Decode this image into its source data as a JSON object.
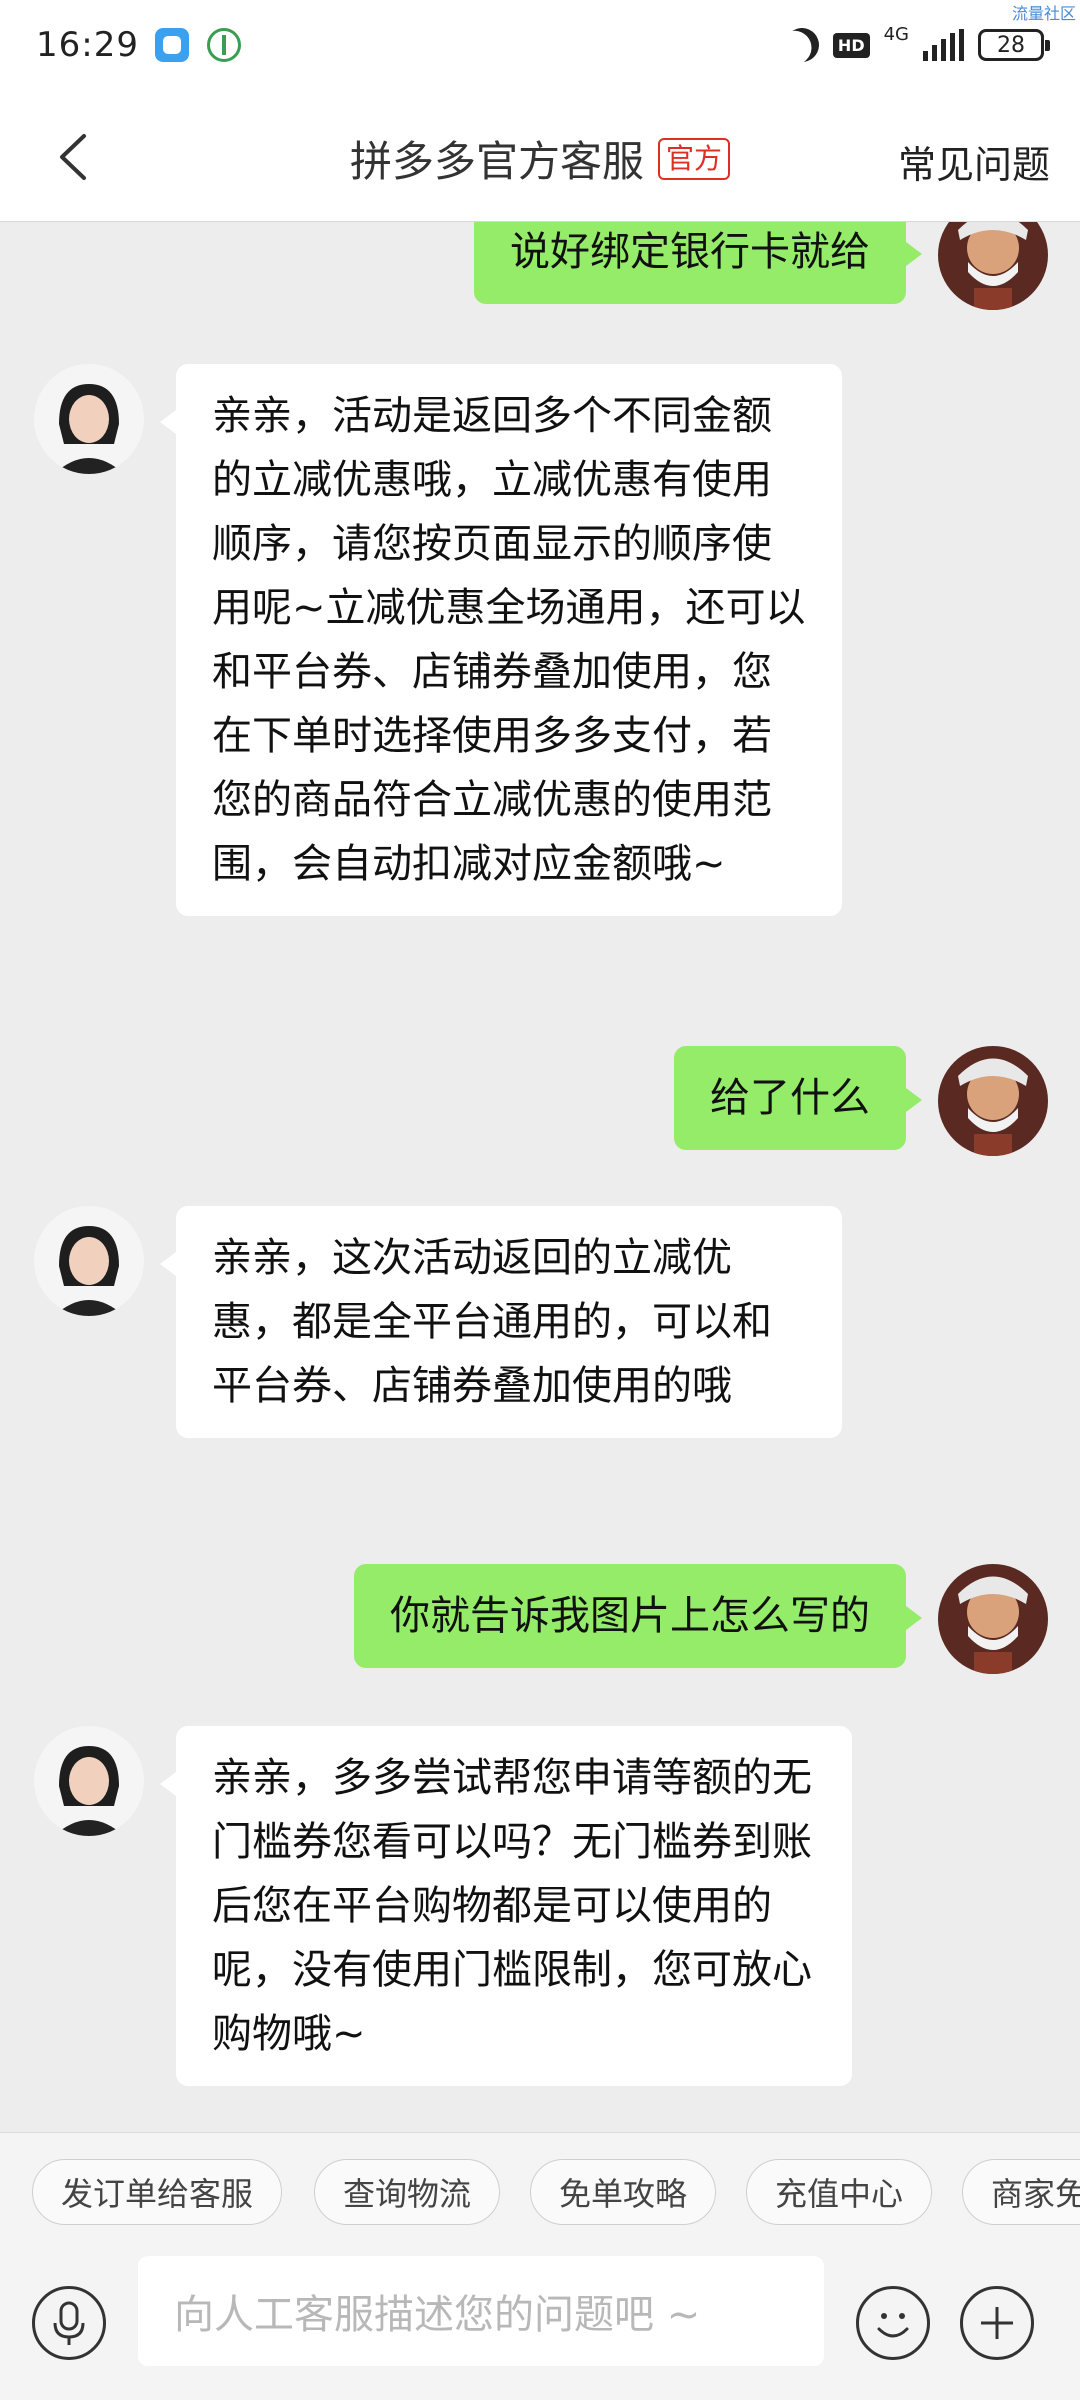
{
  "status_bar": {
    "time": "16:29",
    "hd": "HD",
    "network": "4G",
    "battery": "28",
    "watermark": "流量社区"
  },
  "header": {
    "title": "拼多多官方客服",
    "badge": "官方",
    "faq": "常见问题"
  },
  "messages": [
    {
      "from": "user",
      "text": "说好绑定银行卡就给"
    },
    {
      "from": "agent",
      "text": "亲亲，活动是返回多个不同金额的立减优惠哦，立减优惠有使用顺序，请您按页面显示的顺序使用呢~立减优惠全场通用，还可以和平台券、店铺券叠加使用，您在下单时选择使用多多支付，若您的商品符合立减优惠的使用范围，会自动扣减对应金额哦~"
    },
    {
      "from": "user",
      "text": "给了什么"
    },
    {
      "from": "agent",
      "text": "亲亲，这次活动返回的立减优惠，都是全平台通用的，可以和平台券、店铺券叠加使用的哦"
    },
    {
      "from": "user",
      "text": "你就告诉我图片上怎么写的"
    },
    {
      "from": "agent",
      "text": "亲亲，多多尝试帮您申请等额的无门槛券您看可以吗？无门槛券到账后您在平台购物都是可以使用的呢，没有使用门槛限制，您可放心购物哦~"
    }
  ],
  "quick_replies": [
    "发订单给客服",
    "查询物流",
    "免单攻略",
    "充值中心",
    "商家免"
  ],
  "input": {
    "placeholder": "向人工客服描述您的问题吧 ~"
  },
  "colors": {
    "user_bubble": "#95ec69",
    "agent_bubble": "#ffffff",
    "badge": "#e02e24",
    "background": "#ededed"
  },
  "icons": [
    "back-arrow-icon",
    "microphone-icon",
    "emoji-icon",
    "plus-icon",
    "moon-icon",
    "signal-icon",
    "battery-icon"
  ]
}
